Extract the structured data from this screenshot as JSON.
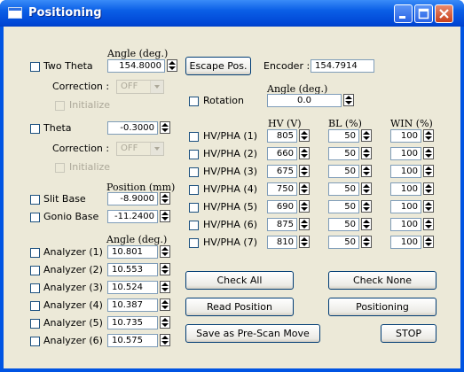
{
  "window": {
    "title": "Positioning"
  },
  "two_theta": {
    "label": "Two Theta",
    "header": "Angle (deg.)",
    "value": "154.8000",
    "correction_label": "Correction :",
    "correction_value": "OFF",
    "initialize_label": "Initialize"
  },
  "theta": {
    "label": "Theta",
    "value": "-0.3000",
    "correction_label": "Correction :",
    "correction_value": "OFF",
    "initialize_label": "Initialize"
  },
  "escape_button": "Escape Pos.",
  "encoder": {
    "label": "Encoder :",
    "value": "154.7914"
  },
  "rotation": {
    "label": "Rotation",
    "header": "Angle (deg.)",
    "value": "0.0"
  },
  "slit": {
    "header": "Position (mm)",
    "items": [
      {
        "label": "Slit Base",
        "value": "-8.9000"
      },
      {
        "label": "Gonio Base",
        "value": "-11.2400"
      }
    ]
  },
  "analyzers": {
    "header": "Angle (deg.)",
    "items": [
      {
        "label": "Analyzer (1)",
        "value": "10.801"
      },
      {
        "label": "Analyzer (2)",
        "value": "10.553"
      },
      {
        "label": "Analyzer (3)",
        "value": "10.524"
      },
      {
        "label": "Analyzer (4)",
        "value": "10.387"
      },
      {
        "label": "Analyzer (5)",
        "value": "10.735"
      },
      {
        "label": "Analyzer (6)",
        "value": "10.575"
      }
    ]
  },
  "hvpha": {
    "headers": {
      "hv": "HV (V)",
      "bl": "BL (%)",
      "win": "WIN (%)"
    },
    "rows": [
      {
        "label": "HV/PHA (1)",
        "hv": "805",
        "bl": "50",
        "win": "100"
      },
      {
        "label": "HV/PHA (2)",
        "hv": "660",
        "bl": "50",
        "win": "100"
      },
      {
        "label": "HV/PHA (3)",
        "hv": "675",
        "bl": "50",
        "win": "100"
      },
      {
        "label": "HV/PHA (4)",
        "hv": "750",
        "bl": "50",
        "win": "100"
      },
      {
        "label": "HV/PHA (5)",
        "hv": "690",
        "bl": "50",
        "win": "100"
      },
      {
        "label": "HV/PHA (6)",
        "hv": "875",
        "bl": "50",
        "win": "100"
      },
      {
        "label": "HV/PHA (7)",
        "hv": "810",
        "bl": "50",
        "win": "100"
      }
    ]
  },
  "buttons": {
    "check_all": "Check All",
    "check_none": "Check None",
    "read_position": "Read Position",
    "positioning": "Positioning",
    "save_prescan": "Save as Pre-Scan Move",
    "stop": "STOP"
  }
}
